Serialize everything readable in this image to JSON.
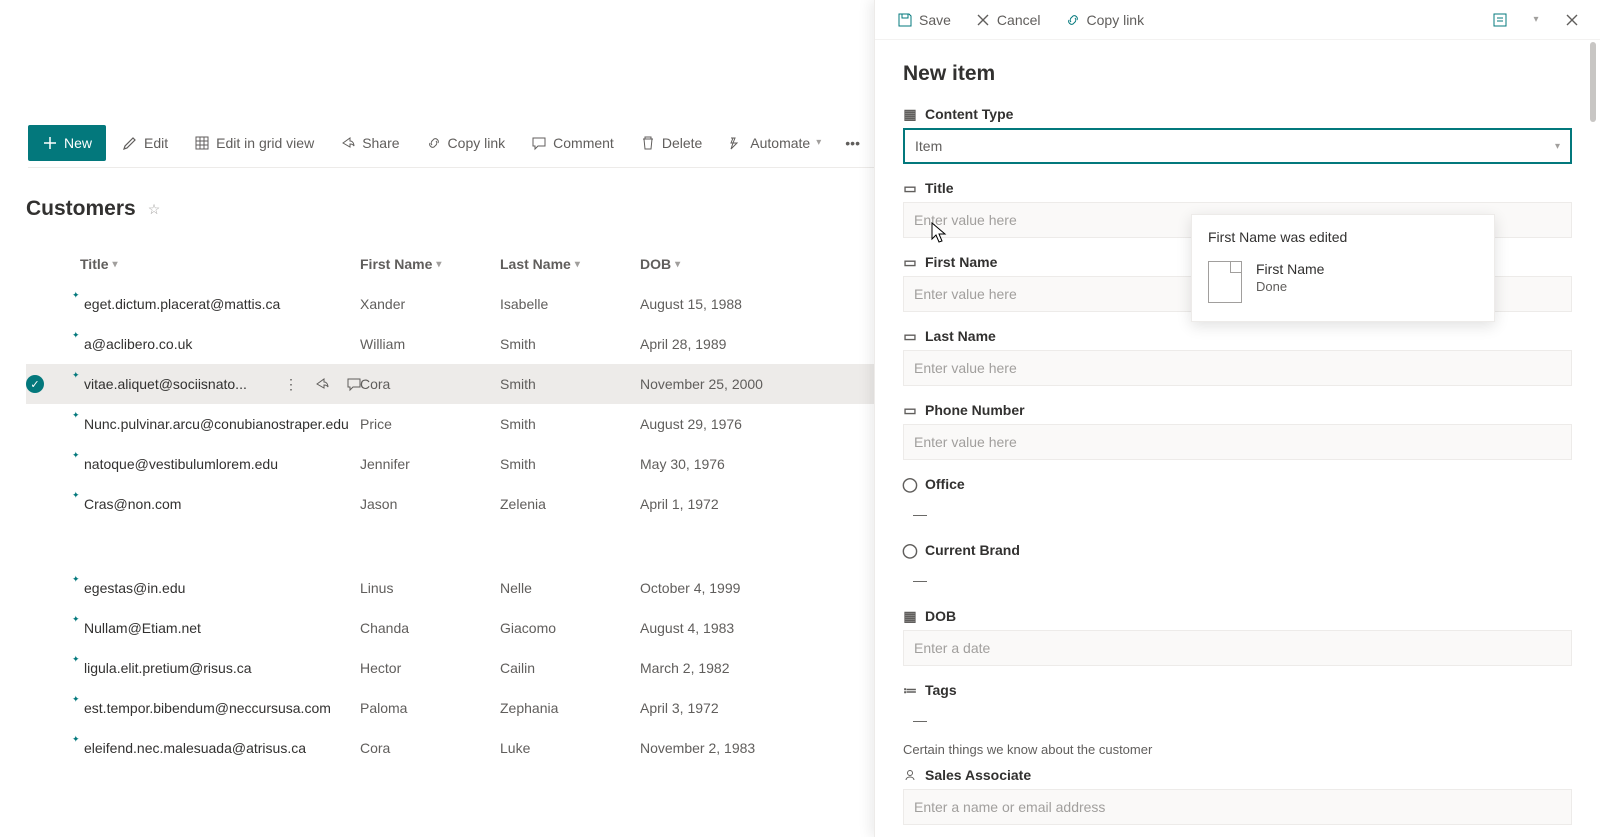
{
  "toolbar": {
    "new_label": "New",
    "edit_label": "Edit",
    "edit_grid_label": "Edit in grid view",
    "share_label": "Share",
    "copylink_label": "Copy link",
    "comment_label": "Comment",
    "delete_label": "Delete",
    "automate_label": "Automate"
  },
  "list": {
    "title": "Customers",
    "columns": {
      "title": "Title",
      "first": "First Name",
      "last": "Last Name",
      "dob": "DOB"
    },
    "rows": [
      {
        "title": "eget.dictum.placerat@mattis.ca",
        "first": "Xander",
        "last": "Isabelle",
        "dob": "August 15, 1988",
        "selected": false
      },
      {
        "title": "a@aclibero.co.uk",
        "first": "William",
        "last": "Smith",
        "dob": "April 28, 1989",
        "selected": false
      },
      {
        "title": "vitae.aliquet@sociisnato...",
        "first": "Cora",
        "last": "Smith",
        "dob": "November 25, 2000",
        "selected": true
      },
      {
        "title": "Nunc.pulvinar.arcu@conubianostraper.edu",
        "first": "Price",
        "last": "Smith",
        "dob": "August 29, 1976",
        "selected": false
      },
      {
        "title": "natoque@vestibulumlorem.edu",
        "first": "Jennifer",
        "last": "Smith",
        "dob": "May 30, 1976",
        "selected": false
      },
      {
        "title": "Cras@non.com",
        "first": "Jason",
        "last": "Zelenia",
        "dob": "April 1, 1972",
        "selected": false
      },
      {
        "spacer": true
      },
      {
        "title": "egestas@in.edu",
        "first": "Linus",
        "last": "Nelle",
        "dob": "October 4, 1999",
        "selected": false
      },
      {
        "title": "Nullam@Etiam.net",
        "first": "Chanda",
        "last": "Giacomo",
        "dob": "August 4, 1983",
        "selected": false
      },
      {
        "title": "ligula.elit.pretium@risus.ca",
        "first": "Hector",
        "last": "Cailin",
        "dob": "March 2, 1982",
        "selected": false
      },
      {
        "title": "est.tempor.bibendum@neccursusa.com",
        "first": "Paloma",
        "last": "Zephania",
        "dob": "April 3, 1972",
        "selected": false
      },
      {
        "title": "eleifend.nec.malesuada@atrisus.ca",
        "first": "Cora",
        "last": "Luke",
        "dob": "November 2, 1983",
        "selected": false
      }
    ]
  },
  "panel": {
    "save_label": "Save",
    "cancel_label": "Cancel",
    "copylink_label": "Copy link",
    "heading": "New item",
    "content_type": {
      "label": "Content Type",
      "value": "Item"
    },
    "title_f": {
      "label": "Title",
      "placeholder": "Enter value here"
    },
    "first_f": {
      "label": "First Name",
      "placeholder": "Enter value here"
    },
    "last_f": {
      "label": "Last Name",
      "placeholder": "Enter value here"
    },
    "phone_f": {
      "label": "Phone Number",
      "placeholder": "Enter value here"
    },
    "office_f": {
      "label": "Office",
      "value": "—"
    },
    "brand_f": {
      "label": "Current Brand",
      "value": "—"
    },
    "dob_f": {
      "label": "DOB",
      "placeholder": "Enter a date"
    },
    "tags_f": {
      "label": "Tags",
      "value": "—"
    },
    "tags_note": "Certain things we know about the customer",
    "sales_f": {
      "label": "Sales Associate",
      "placeholder": "Enter a name or email address"
    }
  },
  "flyout": {
    "heading": "First Name was edited",
    "main": "First Name",
    "sub": "Done"
  }
}
